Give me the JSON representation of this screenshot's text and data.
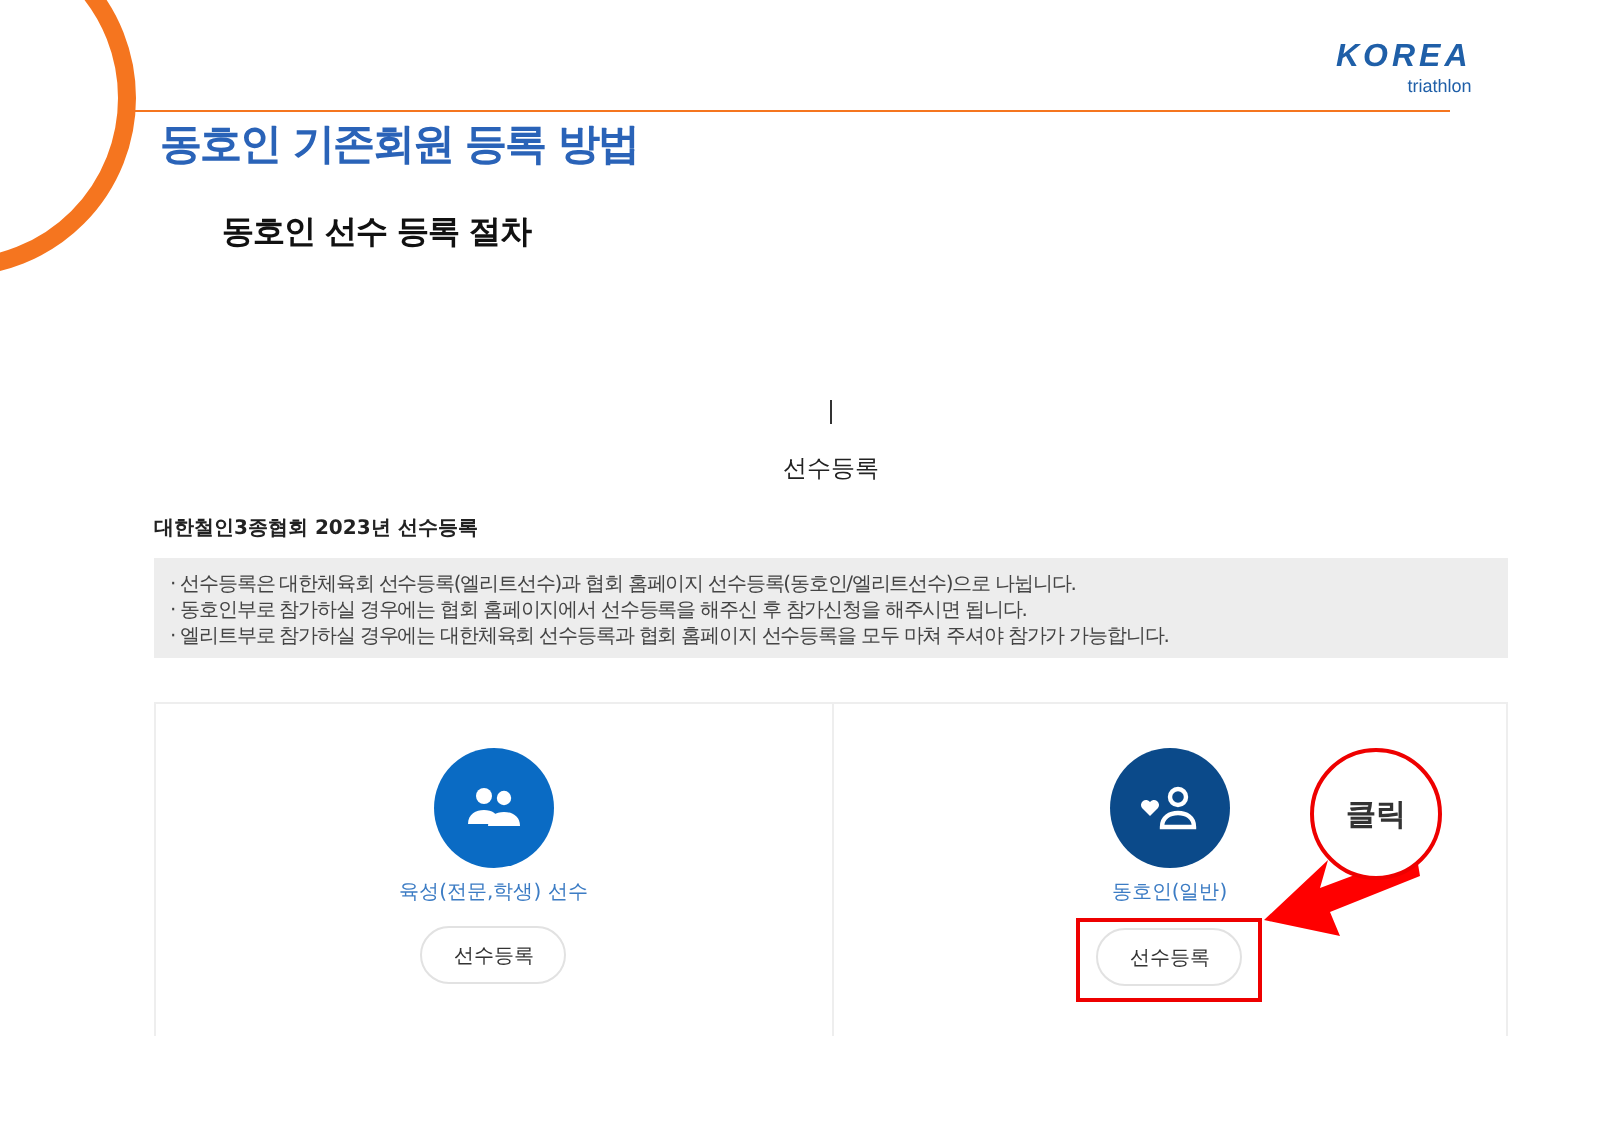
{
  "logo": {
    "wordmark": "KOREA",
    "subtitle": "triathlon"
  },
  "slide": {
    "title": "동호인 기존회원 등록 방법",
    "subtitle": "동호인 선수 등록 절차"
  },
  "page": {
    "heading": "선수등록",
    "section_title": "대한철인3종협회 2023년 선수등록",
    "notices": [
      "· 선수등록은 대한체육회 선수등록(엘리트선수)과 협회 홈페이지 선수등록(동호인/엘리트선수)으로 나뉩니다.",
      "· 동호인부로 참가하실 경우에는 협회 홈페이지에서 선수등록을 해주신 후 참가신청을 해주시면 됩니다.",
      "· 엘리트부로 참가하실 경우에는 대한체육회 선수등록과 협회 홈페이지 선수등록을 모두 마쳐 주셔야 참가가 가능합니다."
    ],
    "cards": [
      {
        "kind": "group",
        "label": "육성(전문,학생) 선수",
        "button": "선수등록",
        "color": "#0a6bc4",
        "highlighted": false
      },
      {
        "kind": "amateur",
        "label": "동호인(일반)",
        "button": "선수등록",
        "color": "#0b4a8a",
        "highlighted": true
      }
    ]
  },
  "callout": {
    "text": "클릭"
  }
}
